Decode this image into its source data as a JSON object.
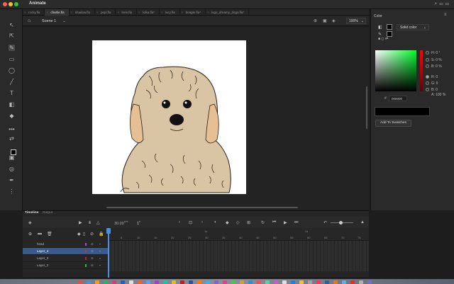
{
  "app": {
    "title": "Animate"
  },
  "tabs": [
    {
      "label": "rocky.fla",
      "active": false
    },
    {
      "label": "charlie.fla",
      "active": true
    },
    {
      "label": "shadow.fla",
      "active": false
    },
    {
      "label": "pepi.fla",
      "active": false
    },
    {
      "label": "lorie.fla",
      "active": false
    },
    {
      "label": "lolka.fla*",
      "active": false
    },
    {
      "label": "lucy.fla",
      "active": false
    },
    {
      "label": "beagle.fla*",
      "active": false
    },
    {
      "label": "logo_dreamy_dogs.fla*",
      "active": false
    }
  ],
  "scene": {
    "label": "Scene 1",
    "zoom": "100%"
  },
  "color_panel": {
    "title": "Color",
    "type": "Solid color",
    "hsb": [
      {
        "label": "H:",
        "value": "0 °"
      },
      {
        "label": "S:",
        "value": "0 %"
      },
      {
        "label": "B:",
        "value": "0 %"
      }
    ],
    "rgb": [
      {
        "label": "R:",
        "value": "0"
      },
      {
        "label": "G:",
        "value": "0"
      },
      {
        "label": "B:",
        "value": "0"
      }
    ],
    "alpha": {
      "label": "A:",
      "value": "100 %"
    },
    "hex_label": "#",
    "hex": "000000",
    "add_swatch": "Add To Swatches"
  },
  "timeline": {
    "tab_timeline": "Timeline",
    "tab_output": "Output",
    "fps": "30.00",
    "fps_unit": "FPS",
    "frame": "1",
    "frame_unit": "F",
    "ruler_seconds": [
      "1s",
      "2s"
    ],
    "ruler_frames": [
      "5",
      "10",
      "15",
      "20",
      "25",
      "30",
      "35",
      "40",
      "45",
      "50",
      "55",
      "60",
      "65",
      "70",
      "75"
    ],
    "layers": [
      {
        "name": "head",
        "color": "#a050c8",
        "selected": false
      },
      {
        "name": "Layer_4",
        "color": "#d03030",
        "selected": true
      },
      {
        "name": "Layer_3",
        "color": "#c02828",
        "selected": false
      },
      {
        "name": "Layer_2",
        "color": "#20c040",
        "selected": false
      }
    ]
  }
}
